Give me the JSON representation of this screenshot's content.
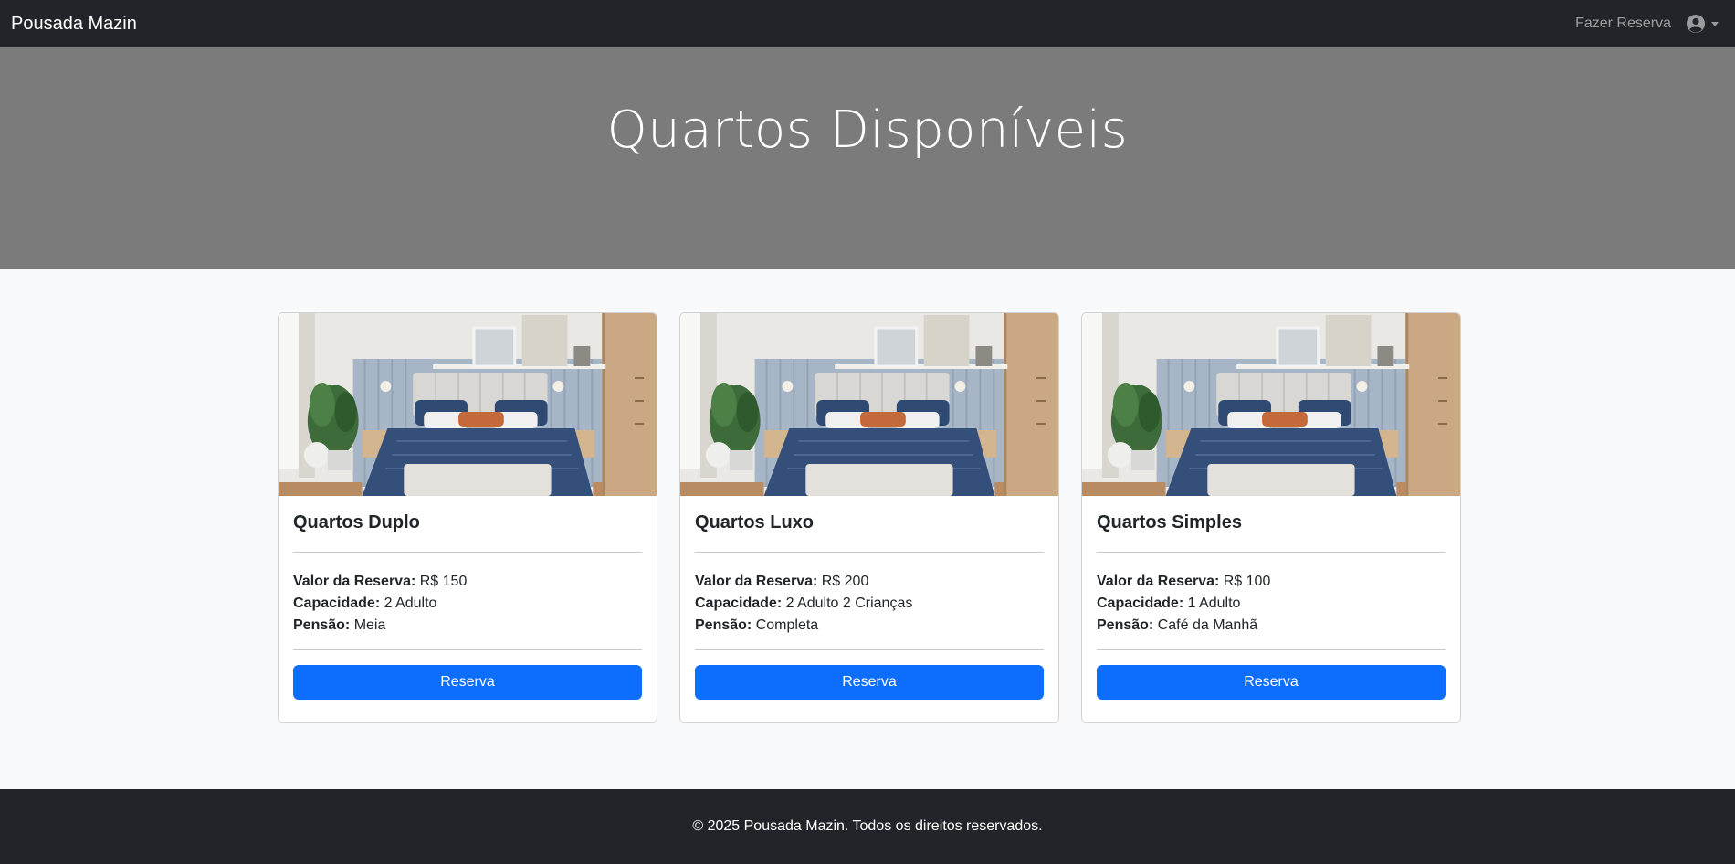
{
  "navbar": {
    "brand": "Pousada Mazin",
    "reserve_link": "Fazer Reserva",
    "user_icon": "user-circle-icon"
  },
  "hero": {
    "title": "Quartos Disponíveis"
  },
  "rooms": [
    {
      "title": "Quartos Duplo",
      "price_label": "Valor da Reserva:",
      "price": "R$ 150",
      "capacity_label": "Capacidade:",
      "capacity": "2 Adulto",
      "board_label": "Pensão:",
      "board": "Meia",
      "button": "Reserva"
    },
    {
      "title": "Quartos Luxo",
      "price_label": "Valor da Reserva:",
      "price": "R$ 200",
      "capacity_label": "Capacidade:",
      "capacity": "2 Adulto 2 Crianças",
      "board_label": "Pensão:",
      "board": "Completa",
      "button": "Reserva"
    },
    {
      "title": "Quartos Simples",
      "price_label": "Valor da Reserva:",
      "price": "R$ 100",
      "capacity_label": "Capacidade:",
      "capacity": "1 Adulto",
      "board_label": "Pensão:",
      "board": "Café da Manhã",
      "button": "Reserva"
    }
  ],
  "footer": {
    "text": "© 2025 Pousada Mazin. Todos os direitos reservados."
  },
  "colors": {
    "navbar_bg": "#212529",
    "hero_bg": "#7b7b7b",
    "primary": "#0d6efd",
    "page_bg": "#f8f9fa"
  }
}
